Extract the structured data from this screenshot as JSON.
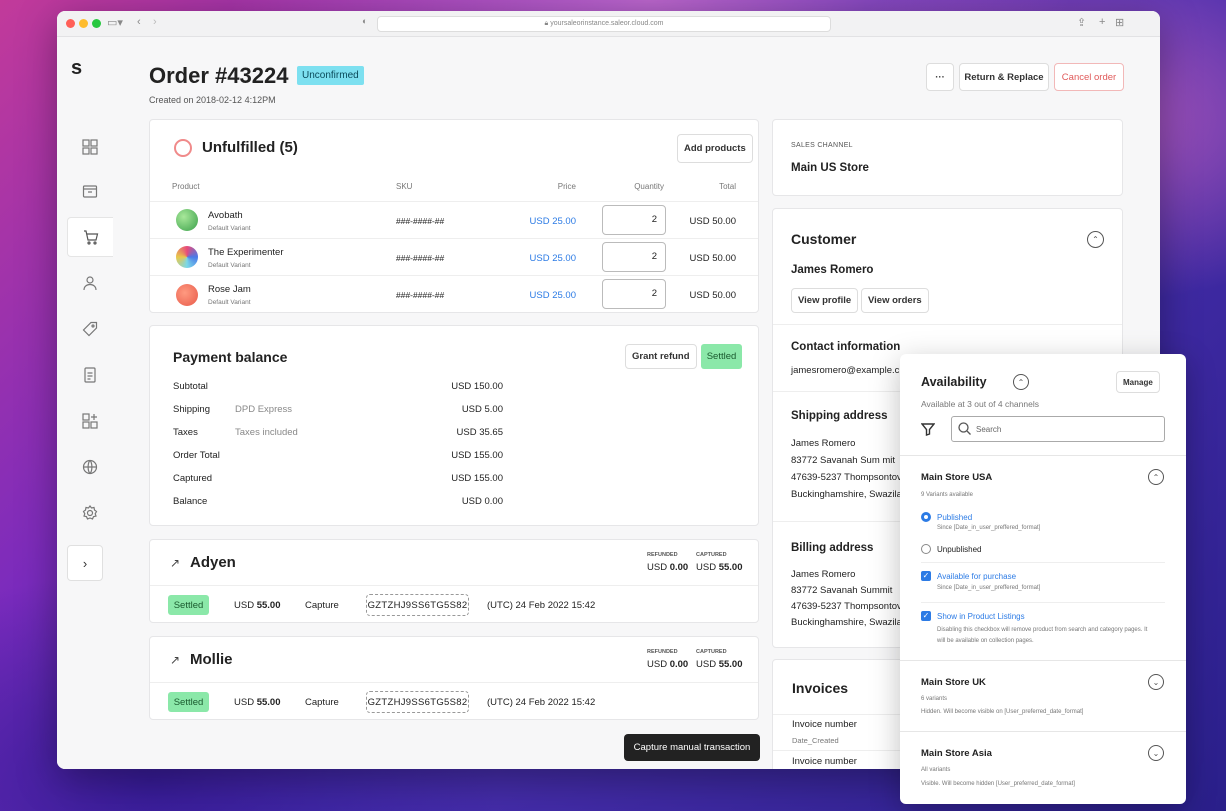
{
  "browser": {
    "url": "yoursaleorinstance.saleor.cloud.com"
  },
  "logo": "s",
  "order": {
    "title": "Order #43224",
    "status": "Unconfirmed",
    "created": "Created on 2018-02-12 4:12PM"
  },
  "header_actions": {
    "more": "···",
    "return_replace": "Return & Replace",
    "cancel": "Cancel order"
  },
  "unfulfilled": {
    "title": "Unfulfilled (5)",
    "add_products": "Add products",
    "columns": [
      "Product",
      "SKU",
      "Price",
      "Quantity",
      "Total"
    ],
    "items": [
      {
        "name": "Avobath",
        "variant": "Default Variant",
        "sku": "###-####-##",
        "price": "USD 25.00",
        "qty": "2",
        "total": "USD 50.00"
      },
      {
        "name": "The Experimenter",
        "variant": "Default Variant",
        "sku": "###-####-##",
        "price": "USD 25.00",
        "qty": "2",
        "total": "USD 50.00"
      },
      {
        "name": "Rose Jam",
        "variant": "Default Variant",
        "sku": "###-####-##",
        "price": "USD 25.00",
        "qty": "2",
        "total": "USD 50.00"
      }
    ]
  },
  "payment": {
    "title": "Payment balance",
    "grant_refund": "Grant refund",
    "status": "Settled",
    "rows": [
      {
        "label": "Subtotal",
        "note": "",
        "value": "USD 150.00"
      },
      {
        "label": "Shipping",
        "note": "DPD Express",
        "value": "USD 5.00"
      },
      {
        "label": "Taxes",
        "note": "Taxes included",
        "value": "USD 35.65"
      },
      {
        "label": "Order Total",
        "note": "",
        "value": "USD 155.00"
      },
      {
        "label": "Captured",
        "note": "",
        "value": "USD 155.00"
      },
      {
        "label": "Balance",
        "note": "",
        "value": "USD 0.00"
      }
    ]
  },
  "transactions": [
    {
      "name": "Adyen",
      "refunded_label": "REFUNDED",
      "captured_label": "CAPTURED",
      "refunded_prefix": "USD ",
      "refunded": "0.00",
      "captured_prefix": "USD ",
      "captured": "55.00",
      "status": "Settled",
      "amount_prefix": "USD ",
      "amount": "55.00",
      "type": "Capture",
      "psp": "GZTZHJ9SS6TG5S82",
      "date": "(UTC) 24 Feb 2022 15:42"
    },
    {
      "name": "Mollie",
      "refunded_label": "REFUNDED",
      "captured_label": "CAPTURED",
      "refunded_prefix": "USD ",
      "refunded": "0.00",
      "captured_prefix": "USD ",
      "captured": "55.00",
      "status": "Settled",
      "amount_prefix": "USD ",
      "amount": "55.00",
      "type": "Capture",
      "psp": "GZTZHJ9SS6TG5S82",
      "date": "(UTC) 24 Feb 2022 15:42"
    }
  ],
  "capture_manual": "Capture manual transaction",
  "sales_channel": {
    "label": "SALES CHANNEL",
    "value": "Main US Store"
  },
  "customer": {
    "title": "Customer",
    "name": "James Romero",
    "view_profile": "View profile",
    "view_orders": "View orders"
  },
  "contact": {
    "title": "Contact information",
    "email": "jamesromero@example.c"
  },
  "shipping": {
    "title": "Shipping address",
    "lines": [
      "James Romero",
      "83772 Savanah Sum mit",
      "47639-5237 Thompsontov",
      "Buckinghamshire, Swazila"
    ]
  },
  "billing": {
    "title": "Billing address",
    "lines": [
      "James Romero",
      "83772 Savanah Summit",
      "47639-5237 Thompsontov",
      "Buckinghamshire, Swazila"
    ]
  },
  "invoices": {
    "title": "Invoices",
    "number_label": "Invoice number",
    "date_created": "Date_Created",
    "number_label2": "Invoice number"
  },
  "availability": {
    "title": "Availability",
    "manage": "Manage",
    "subtitle": "Available at 3 out of 4 channels",
    "search_placeholder": "Search",
    "channels": [
      {
        "name": "Main Store USA",
        "sub": "9 Variants available",
        "published": "Published",
        "published_since": "Since [Date_in_user_preffered_format]",
        "unpublished": "Unpublished",
        "available": "Available for purchase",
        "available_since": "Since [Date_in_user_preffered_format]",
        "listings": "Show in Product Listings",
        "listings_note": "Disabling this checkbox will remove product from search and category pages. It will be available on collection pages."
      },
      {
        "name": "Main Store UK",
        "sub": "6 variants",
        "note": "Hidden. Will become visible on [User_preferred_date_format]"
      },
      {
        "name": "Main Store Asia",
        "sub": "All variants",
        "note": "Visible. Will become hidden [User_preferred_date_format]"
      }
    ]
  }
}
